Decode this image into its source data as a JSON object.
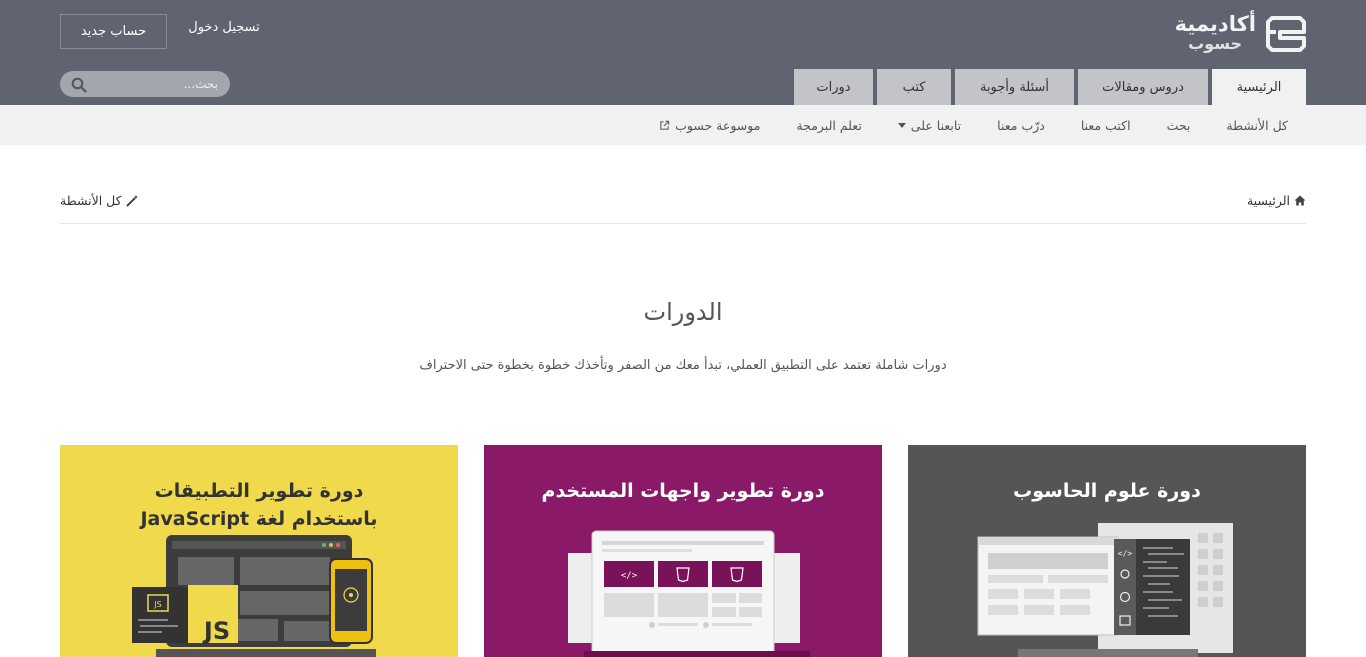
{
  "brand": {
    "title": "أكاديمية",
    "subtitle": "حسوب"
  },
  "auth": {
    "signup_label": "حساب جديد",
    "login_label": "تسجيل دخول"
  },
  "search": {
    "placeholder": "بحث..."
  },
  "tabs": [
    {
      "label": "الرئيسية",
      "active": true
    },
    {
      "label": "دروس ومقالات",
      "active": false
    },
    {
      "label": "أسئلة وأجوبة",
      "active": false
    },
    {
      "label": "كتب",
      "active": false
    },
    {
      "label": "دورات",
      "active": false
    }
  ],
  "subnav": [
    {
      "label": "كل الأنشطة"
    },
    {
      "label": "بحث"
    },
    {
      "label": "اكتب معنا"
    },
    {
      "label": "درّب معنا"
    },
    {
      "label": "تابعنا على"
    },
    {
      "label": "تعلم البرمجة"
    },
    {
      "label": "موسوعة حسوب"
    }
  ],
  "breadcrumb": {
    "home_label": "الرئيسية",
    "all_activity_label": "كل الأنشطة"
  },
  "page": {
    "title": "الدورات",
    "description": "دورات شاملة تعتمد على التطبيق العملي، تبدأ معك من الصفر وتأخذك خطوة بخطوة حتى الاحتراف"
  },
  "cards": [
    {
      "title": "دورة علوم الحاسوب",
      "bg": "#555555"
    },
    {
      "title": "دورة تطوير واجهات المستخدم",
      "bg": "#8a1a68"
    },
    {
      "title_line1": "دورة تطوير التطبيقات",
      "title_line2": "باستخدام لغة JavaScript",
      "bg": "#f0d94a",
      "badge_js": "JS",
      "badge_js_small": "JS"
    }
  ],
  "colors": {
    "header_bg": "#606370",
    "tab_bg": "#c3c4c8",
    "tab_active_bg": "#f1f1f1",
    "subnav_bg": "#f1f1f1"
  }
}
